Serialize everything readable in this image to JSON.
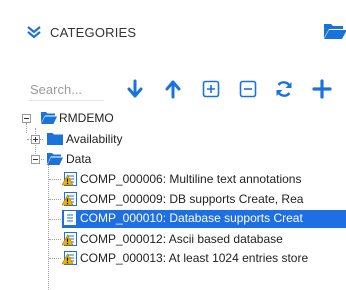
{
  "header": {
    "title": "CATEGORIES",
    "collapse_icon": "double-chevron-down-icon",
    "folder_icon": "folder-open-icon"
  },
  "toolbar": {
    "search_placeholder": "Search...",
    "buttons": [
      "arrow-down-icon",
      "arrow-up-icon",
      "expand-all-icon",
      "collapse-all-icon",
      "refresh-icon",
      "add-icon"
    ]
  },
  "tree": {
    "root": "RMDEMO",
    "availability": "Availability",
    "data": "Data",
    "items": [
      {
        "label": "COMP_000006: Multiline text annotations",
        "icon": "warning-document-icon",
        "selected": false
      },
      {
        "label": "COMP_000009: DB supports Create, Rea",
        "icon": "warning-document-icon",
        "selected": false
      },
      {
        "label": "COMP_000010: Database supports Creat",
        "icon": "document-icon",
        "selected": true
      },
      {
        "label": "COMP_000012: Ascii based database",
        "icon": "warning-document-icon",
        "selected": false
      },
      {
        "label": "COMP_000013: At least 1024 entries store",
        "icon": "warning-document-icon",
        "selected": false
      }
    ]
  },
  "colors": {
    "accent": "#1e6fe3",
    "folder": "#1a73d9",
    "warning": "#f0b400"
  }
}
